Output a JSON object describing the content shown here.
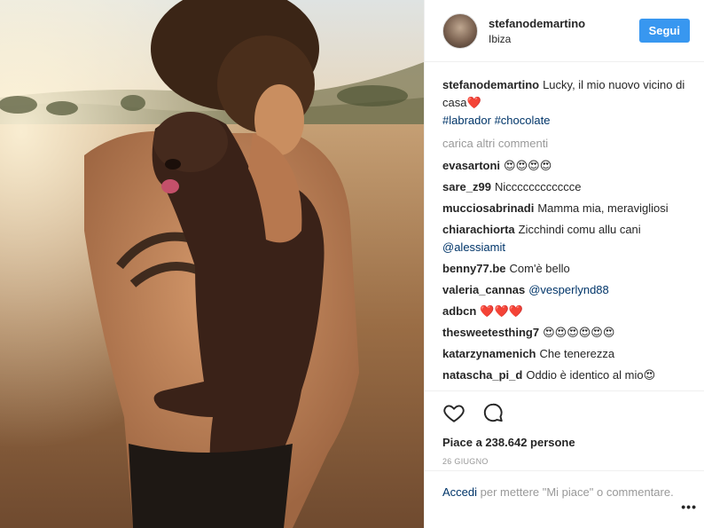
{
  "header": {
    "username": "stefanodemartino",
    "location": "Ibiza",
    "follow_label": "Segui"
  },
  "caption": {
    "author": "stefanodemartino",
    "text": "Lucky, il mio nuovo vicino di casa❤️",
    "hashtags": [
      "#labrador",
      "#chocolate"
    ]
  },
  "load_more_label": "carica altri commenti",
  "comments": [
    {
      "author": "evasartoni",
      "text": "😍😍😍😍"
    },
    {
      "author": "sare_z99",
      "text": "Nicccccccccccce"
    },
    {
      "author": "mucciosabrinadi",
      "text": "Mamma mia, meravigliosi"
    },
    {
      "author": "chiarachiorta",
      "text": "Zicchindi comu allu cani",
      "mention": "@alessiamit"
    },
    {
      "author": "benny77.be",
      "text": "Com'è bello"
    },
    {
      "author": "valeria_cannas",
      "text": "",
      "mention": "@vesperlynd88"
    },
    {
      "author": "adbcn",
      "text": "❤️❤️❤️"
    },
    {
      "author": "thesweetesthing7",
      "text": "😍😍😍😍😍😍"
    },
    {
      "author": "katarzynamenich",
      "text": "Che tenerezza"
    },
    {
      "author": "natascha_pi_d",
      "text": "Oddio è identico al mio😍"
    },
    {
      "author": "",
      "text": "😍😍😍"
    }
  ],
  "likes_text": "Piace a 238.642 persone",
  "date": "26 GIUGNO",
  "add_comment": {
    "login_label": "Accedi",
    "rest_text": "per mettere \"Mi piace\" o commentare."
  },
  "more_label": "•••",
  "icons": {
    "like": "heart-icon",
    "comment": "comment-bubble-icon"
  }
}
